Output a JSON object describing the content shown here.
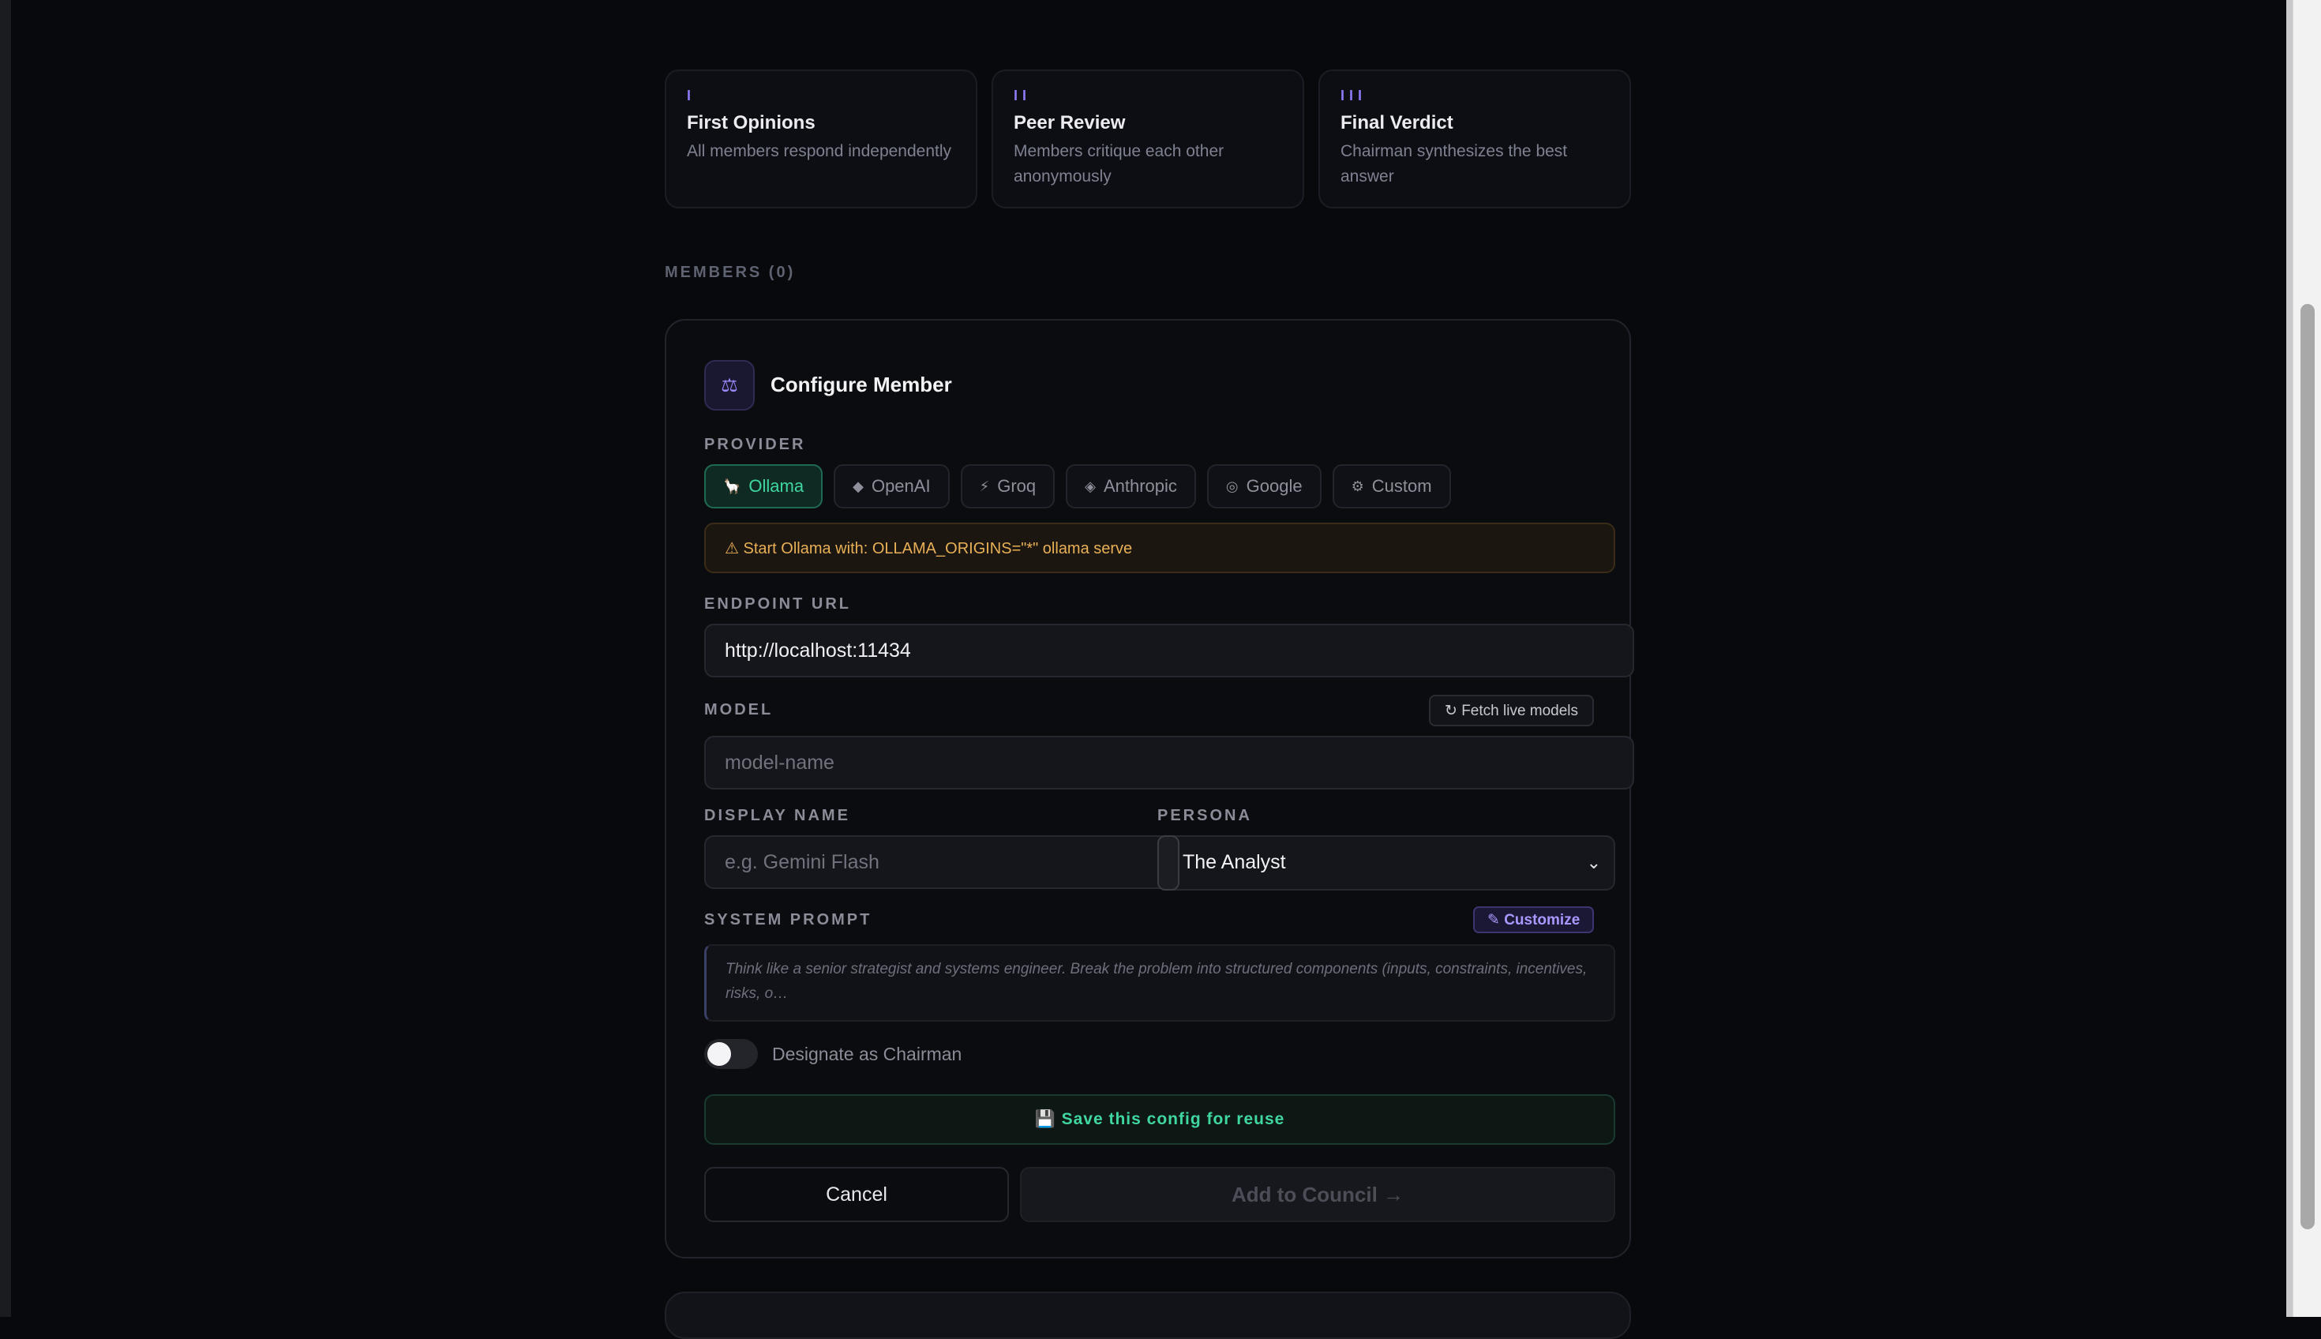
{
  "stages": [
    {
      "mark": "I",
      "title": "First Opinions",
      "desc": "All members respond independently"
    },
    {
      "mark": "II",
      "title": "Peer Review",
      "desc": "Members critique each other anonymously"
    },
    {
      "mark": "III",
      "title": "Final Verdict",
      "desc": "Chairman synthesizes the best answer"
    }
  ],
  "members_label": "MEMBERS (0)",
  "panel": {
    "header_icon": "⚖",
    "title": "Configure Member",
    "provider_label": "PROVIDER",
    "providers": [
      {
        "icon": "🦙",
        "label": "Ollama",
        "active": true
      },
      {
        "icon": "◆",
        "label": "OpenAI"
      },
      {
        "icon": "⚡",
        "label": "Groq"
      },
      {
        "icon": "◈",
        "label": "Anthropic"
      },
      {
        "icon": "◎",
        "label": "Google"
      },
      {
        "icon": "⚙",
        "label": "Custom"
      }
    ],
    "warning": "⚠ Start Ollama with: OLLAMA_ORIGINS=\"*\" ollama serve",
    "endpoint_label": "ENDPOINT URL",
    "endpoint_value": "http://localhost:11434",
    "model_label": "MODEL",
    "fetch_label": "↻ Fetch live models",
    "model_placeholder": "model-name",
    "display_name_label": "DISPLAY NAME",
    "display_name_placeholder": "e.g. Gemini Flash",
    "persona_label": "PERSONA",
    "persona_value": "The Analyst",
    "system_prompt_label": "SYSTEM PROMPT",
    "customize_label": "✎ Customize",
    "system_prompt_text": "Think like a senior strategist and systems engineer. Break the problem into structured components (inputs, constraints, incentives, risks, o…",
    "chairman_label": "Designate as Chairman",
    "chairman_on": false,
    "save_label": "💾 Save this config for reuse",
    "cancel_label": "Cancel",
    "add_label": "Add to Council →"
  },
  "colors": {
    "accent_green": "#3fd6a0",
    "accent_purple": "#8b7cf6",
    "warning": "#e8b056"
  }
}
